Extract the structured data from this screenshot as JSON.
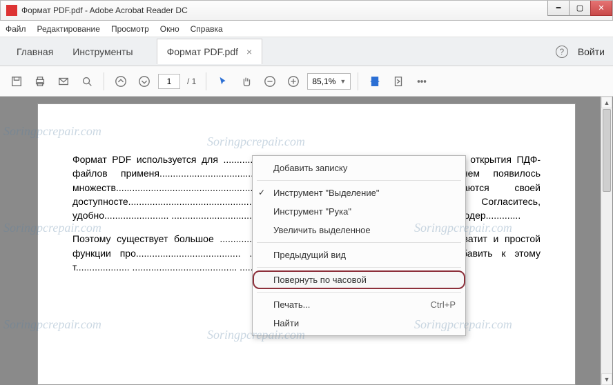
{
  "titlebar": {
    "title": "Формат PDF.pdf - Adobe Acrobat Reader DC"
  },
  "menubar": {
    "items": [
      "Файл",
      "Редактирование",
      "Просмотр",
      "Окно",
      "Справка"
    ]
  },
  "tabs": {
    "home": "Главная",
    "tools": "Инструменты",
    "doc": "Формат PDF.pdf"
  },
  "header_right": {
    "login": "Войти"
  },
  "toolbar": {
    "page_current": "1",
    "page_total": "/ 1",
    "zoom": "85,1%"
  },
  "document": {
    "p1": "Формат PDF используется для ......................................................... ....................... для открытия ПДФ-файлов применя.................................... ........................................ ю со временем появилось множеств................................................... ...................... сложения различаются своей доступносте................................................ ................... ительных функций. Согласитесь, удобно........................ ........................................ ....................... редактировать исходное содер.............",
    "p2": "Поэтому существует большое ................................................ ....................... ому-то хватит и простой функции про....................................... ........................ елный текст документа, добавить к этому т.................... ....................................... ......... PDF и многое другое."
  },
  "context_menu": {
    "items": {
      "add_note": "Добавить записку",
      "tool_select": "Инструмент \"Выделение\"",
      "tool_hand": "Инструмент \"Рука\"",
      "zoom_selection": "Увеличить выделенное",
      "prev_view": "Предыдущий вид",
      "rotate_cw": "Повернуть по часовой",
      "print": "Печать...",
      "print_shortcut": "Ctrl+P",
      "find": "Найти"
    }
  },
  "watermark": "Soringpcrepair.com"
}
